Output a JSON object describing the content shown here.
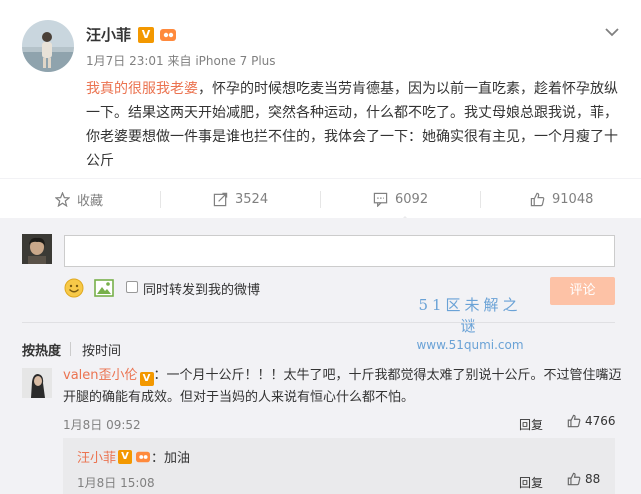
{
  "post": {
    "author_name": "汪小菲",
    "verified_mark": "V",
    "timestamp": "1月7日 23:01",
    "source": "来自 iPhone 7 Plus",
    "text_highlight": "我真的很服我老婆",
    "text_rest": "，怀孕的时候想吃麦当劳肯德基，因为以前一直吃素，趁着怀孕放纵一下。结果这两天开始减肥，突然各种运动，什么都不吃了。我丈母娘总跟我说，菲，你老婆要想做一件事是谁也拦不住的，我体会了一下：她确实很有主见，一个月瘦了十公斤"
  },
  "actions": {
    "favorite_label": "收藏",
    "repost_count": "3524",
    "comment_count": "6092",
    "like_count": "91048"
  },
  "composer": {
    "also_repost_label": "同时转发到我的微博",
    "submit_label": "评论"
  },
  "watermark": {
    "title": "51区未解之谜",
    "url": "www.51qumi.com"
  },
  "sort": {
    "hot_label": "按热度",
    "time_label": "按时间"
  },
  "comments": [
    {
      "username": "valen歪小伦",
      "verified_mark": "V",
      "text": "：一个月十公斤！！！太牛了吧，十斤我都觉得太难了别说十公斤。不过管住嘴迈开腿的确能有成效。但对于当妈的人来说有恒心什么都不怕。",
      "time": "1月8日 09:52",
      "reply_label": "回复",
      "likes": "4766",
      "replies": [
        {
          "username": "汪小菲",
          "verified_mark": "V",
          "text": "：加油",
          "time": "1月8日 15:08",
          "reply_label": "回复",
          "likes": "88"
        }
      ]
    }
  ],
  "colors": {
    "accent_orange": "#eb7350",
    "verified_gold": "#f39800",
    "background_gray": "#f2f2f5",
    "submit_disabled": "#fdc2a6"
  }
}
